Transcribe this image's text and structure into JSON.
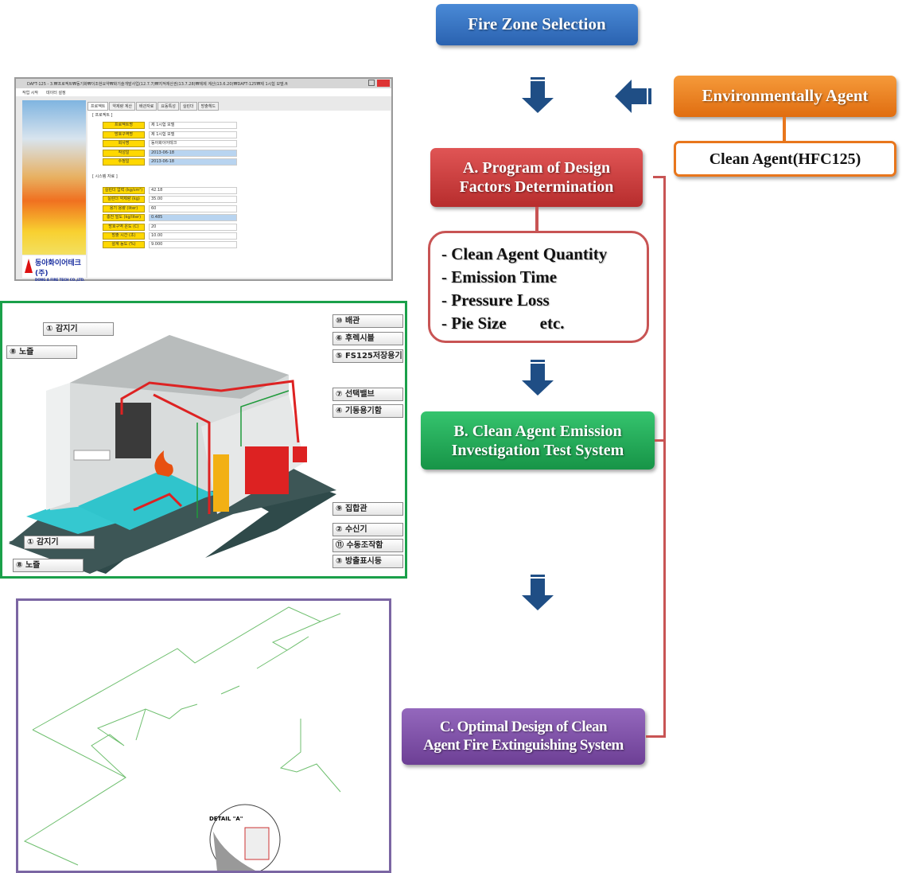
{
  "flow": {
    "fire_zone": "Fire Zone Selection",
    "env_agent": "Environmentally Agent",
    "clean_agent": "Clean Agent(HFC125)",
    "step_a": [
      "A. Program of  Design",
      "Factors Determination"
    ],
    "factors": [
      "- Clean Agent Quantity",
      "- Emission Time",
      "- Pressure Loss",
      "- Pie Size        etc."
    ],
    "step_b": [
      "B. Clean Agent Emission",
      "Investigation Test System"
    ],
    "step_c": [
      "C. Optimal Design of Clean",
      "Agent Fire Extinguishing System"
    ],
    "colors": {
      "blue": "#2f6fc0",
      "orange": "#e8761c",
      "red": "#c83a3a",
      "green": "#1fa855",
      "purple": "#7d4fa3",
      "arrow": "#1f4e85"
    }
  },
  "software": {
    "title": "DAFT-125 - 3.₩프로젝트₩동기화₩이조현요약₩화기술개발사업(12.7.7)₩지적재산권(13.7.28)₩에제 계산(13.6.20)₩DAFT-125₩제 1시험 모델.ft",
    "menu": [
      "작업 시작",
      "데이터 설정"
    ],
    "tabs": [
      "프로젝트",
      "약제량 계산",
      "배관자료",
      "요동특성",
      "실린더",
      "방출헤드"
    ],
    "logo_text": "동아화이어테크(주)",
    "logo_sub": "DONG A FIRE TECH CO.,LTD.",
    "section_project": "[ 프로젝트 ]",
    "section_system": "[ 시스템 자료 ]",
    "project_fields": [
      {
        "label": "프로젝트명",
        "value": "제 1시험 모델"
      },
      {
        "label": "방호구역명",
        "value": "제 1시험 모델"
      },
      {
        "label": "회사명",
        "value": "동아화이어테크"
      },
      {
        "label": "작성일",
        "value": "2013-06-18"
      },
      {
        "label": "수정일",
        "value": "2013-06-18"
      }
    ],
    "system_fields": [
      {
        "label": "실린더 압력 (kg/cm²)",
        "value": "42.18"
      },
      {
        "label": "실린더 약제량 (kg)",
        "value": "35.00"
      },
      {
        "label": "용기 용량 (liter)",
        "value": "60"
      },
      {
        "label": "충전 밀도 (kg/liter)",
        "value": "0.485"
      },
      {
        "label": "방호구역 온도 (C)",
        "value": "20"
      },
      {
        "label": "방출 시간 (초)",
        "value": "10.00"
      },
      {
        "label": "설계 농도 (%)",
        "value": "9.000"
      }
    ]
  },
  "system_diagram": {
    "labels": [
      "① 감지기",
      "⑧ 노즐",
      "⑩ 배관",
      "⑥ 후렉시블",
      "⑤ FS125저장용기",
      "⑦ 선택밸브",
      "④ 기동용기함",
      "⑨ 집합관",
      "② 수신기",
      "⑪ 수동조작함",
      "③ 방출표시등",
      "① 감지기",
      "⑧ 노즐"
    ]
  },
  "piping_drawing": {
    "detail_label": "DETAIL \"A\""
  }
}
